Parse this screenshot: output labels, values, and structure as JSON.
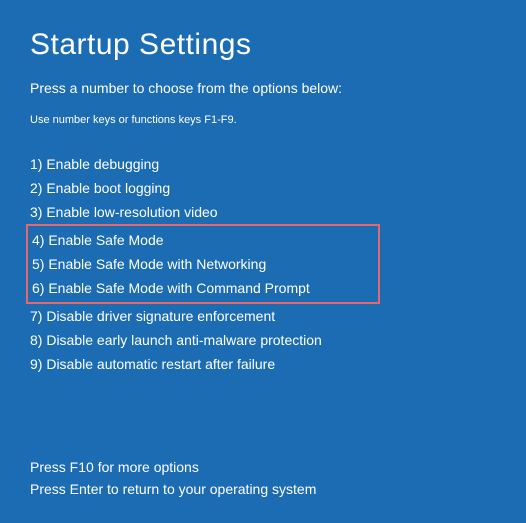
{
  "title": "Startup Settings",
  "subtitle": "Press a number to choose from the options below:",
  "hint": "Use number keys or functions keys F1-F9.",
  "options": [
    "1) Enable debugging",
    "2) Enable boot logging",
    "3) Enable low-resolution video",
    "4) Enable Safe Mode",
    "5) Enable Safe Mode with Networking",
    "6) Enable Safe Mode with Command Prompt",
    "7) Disable driver signature enforcement",
    "8) Disable early launch anti-malware protection",
    "9) Disable automatic restart after failure"
  ],
  "footer": {
    "more": "Press F10 for more options",
    "enter": "Press Enter to return to your operating system"
  },
  "highlight_range": [
    3,
    5
  ]
}
